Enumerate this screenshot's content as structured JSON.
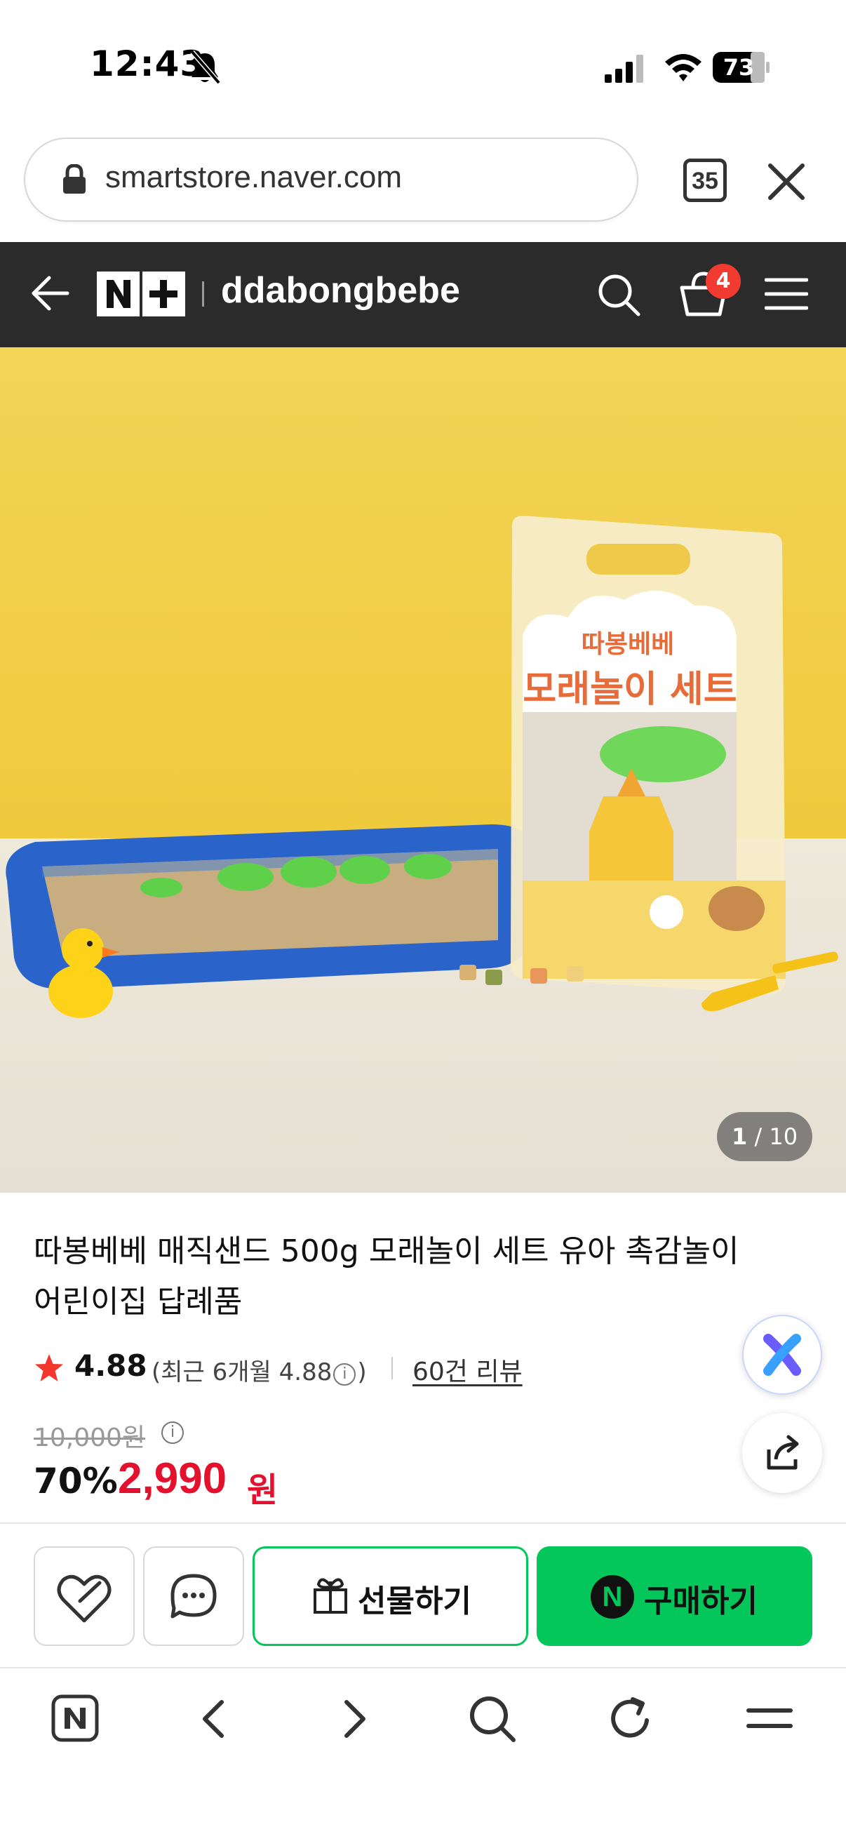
{
  "status_bar": {
    "time": "12:43",
    "battery": "73"
  },
  "browser": {
    "url": "smartstore.naver.com",
    "tab_count": "35"
  },
  "store_header": {
    "store_name": "ddabongbebe",
    "cart_count": "4"
  },
  "product_image": {
    "package_line1": "따봉베베",
    "package_line2": "모래놀이 세트",
    "counter_current": "1",
    "counter_total": "/ 10"
  },
  "product": {
    "title": "따봉베베 매직샌드 500g 모래놀이 세트 유아 촉감놀이 어린이집 답례품",
    "rating": "4.88",
    "rating_recent_prefix": "(최근 6개월 4.88",
    "rating_recent_suffix": ")",
    "review_link": "60건 리뷰",
    "original_price": "10,000원",
    "discount": "70%",
    "sale_price": "2,990",
    "sale_unit": "원"
  },
  "actions": {
    "gift_label": "선물하기",
    "buy_label": "구매하기",
    "npay_letter": "N"
  },
  "colors": {
    "header_bg": "#2b2b2b",
    "naver_green": "#03c75a",
    "price_red": "#e4112e",
    "badge_red": "#f23b30",
    "background_yellow": "#f2cf4a"
  }
}
